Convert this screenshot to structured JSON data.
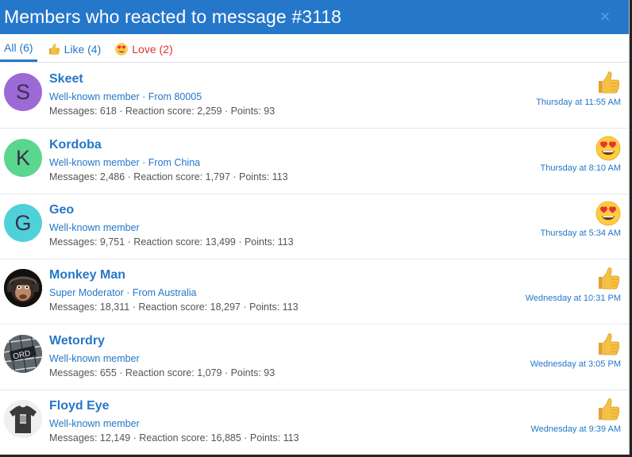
{
  "modal": {
    "title": "Members who reacted to message #3118",
    "close_glyph": "×"
  },
  "tabs": [
    {
      "label": "All (6)"
    },
    {
      "label": "Like (4)",
      "icon": "thumbs-up-icon"
    },
    {
      "label": "Love (2)",
      "icon": "heart-eyes-icon"
    }
  ],
  "members": [
    {
      "name": "Skeet",
      "title": "Well-known member · From 80005",
      "stats": "Messages: 618 · Reaction score: 2,259 · Points: 93",
      "time": "Thursday at 11:55 AM",
      "reaction": "like",
      "avatar_letter": "S",
      "avatar_color": "#9b6ad6"
    },
    {
      "name": "Kordoba",
      "title": "Well-known member · From China",
      "stats": "Messages: 2,486 · Reaction score: 1,797 · Points: 113",
      "time": "Thursday at 8:10 AM",
      "reaction": "love",
      "avatar_letter": "K",
      "avatar_color": "#5ad68e"
    },
    {
      "name": "Geo",
      "title": "Well-known member",
      "stats": "Messages: 9,751 · Reaction score: 13,499 · Points: 113",
      "time": "Thursday at 5:34 AM",
      "reaction": "love",
      "avatar_letter": "G",
      "avatar_color": "#4fd1d9"
    },
    {
      "name": "Monkey Man",
      "title": "Super Moderator · From Australia",
      "stats": "Messages: 18,311 · Reaction score: 18,297 · Points: 113",
      "time": "Wednesday at 10:31 PM",
      "reaction": "like",
      "avatar_letter": "",
      "avatar_color": "#1c1612"
    },
    {
      "name": "Wetordry",
      "title": "Well-known member",
      "stats": "Messages: 655 · Reaction score: 1,079 · Points: 93",
      "time": "Wednesday at 3:05 PM",
      "reaction": "like",
      "avatar_letter": "",
      "avatar_color": "#6b7278"
    },
    {
      "name": "Floyd Eye",
      "title": "Well-known member",
      "stats": "Messages: 12,149 · Reaction score: 16,885 · Points: 113",
      "time": "Wednesday at 9:39 AM",
      "reaction": "like",
      "avatar_letter": "",
      "avatar_color": "#e9e9e9"
    }
  ],
  "colors": {
    "header": "#2577c9",
    "link": "#2577c9",
    "love": "#e03232"
  }
}
